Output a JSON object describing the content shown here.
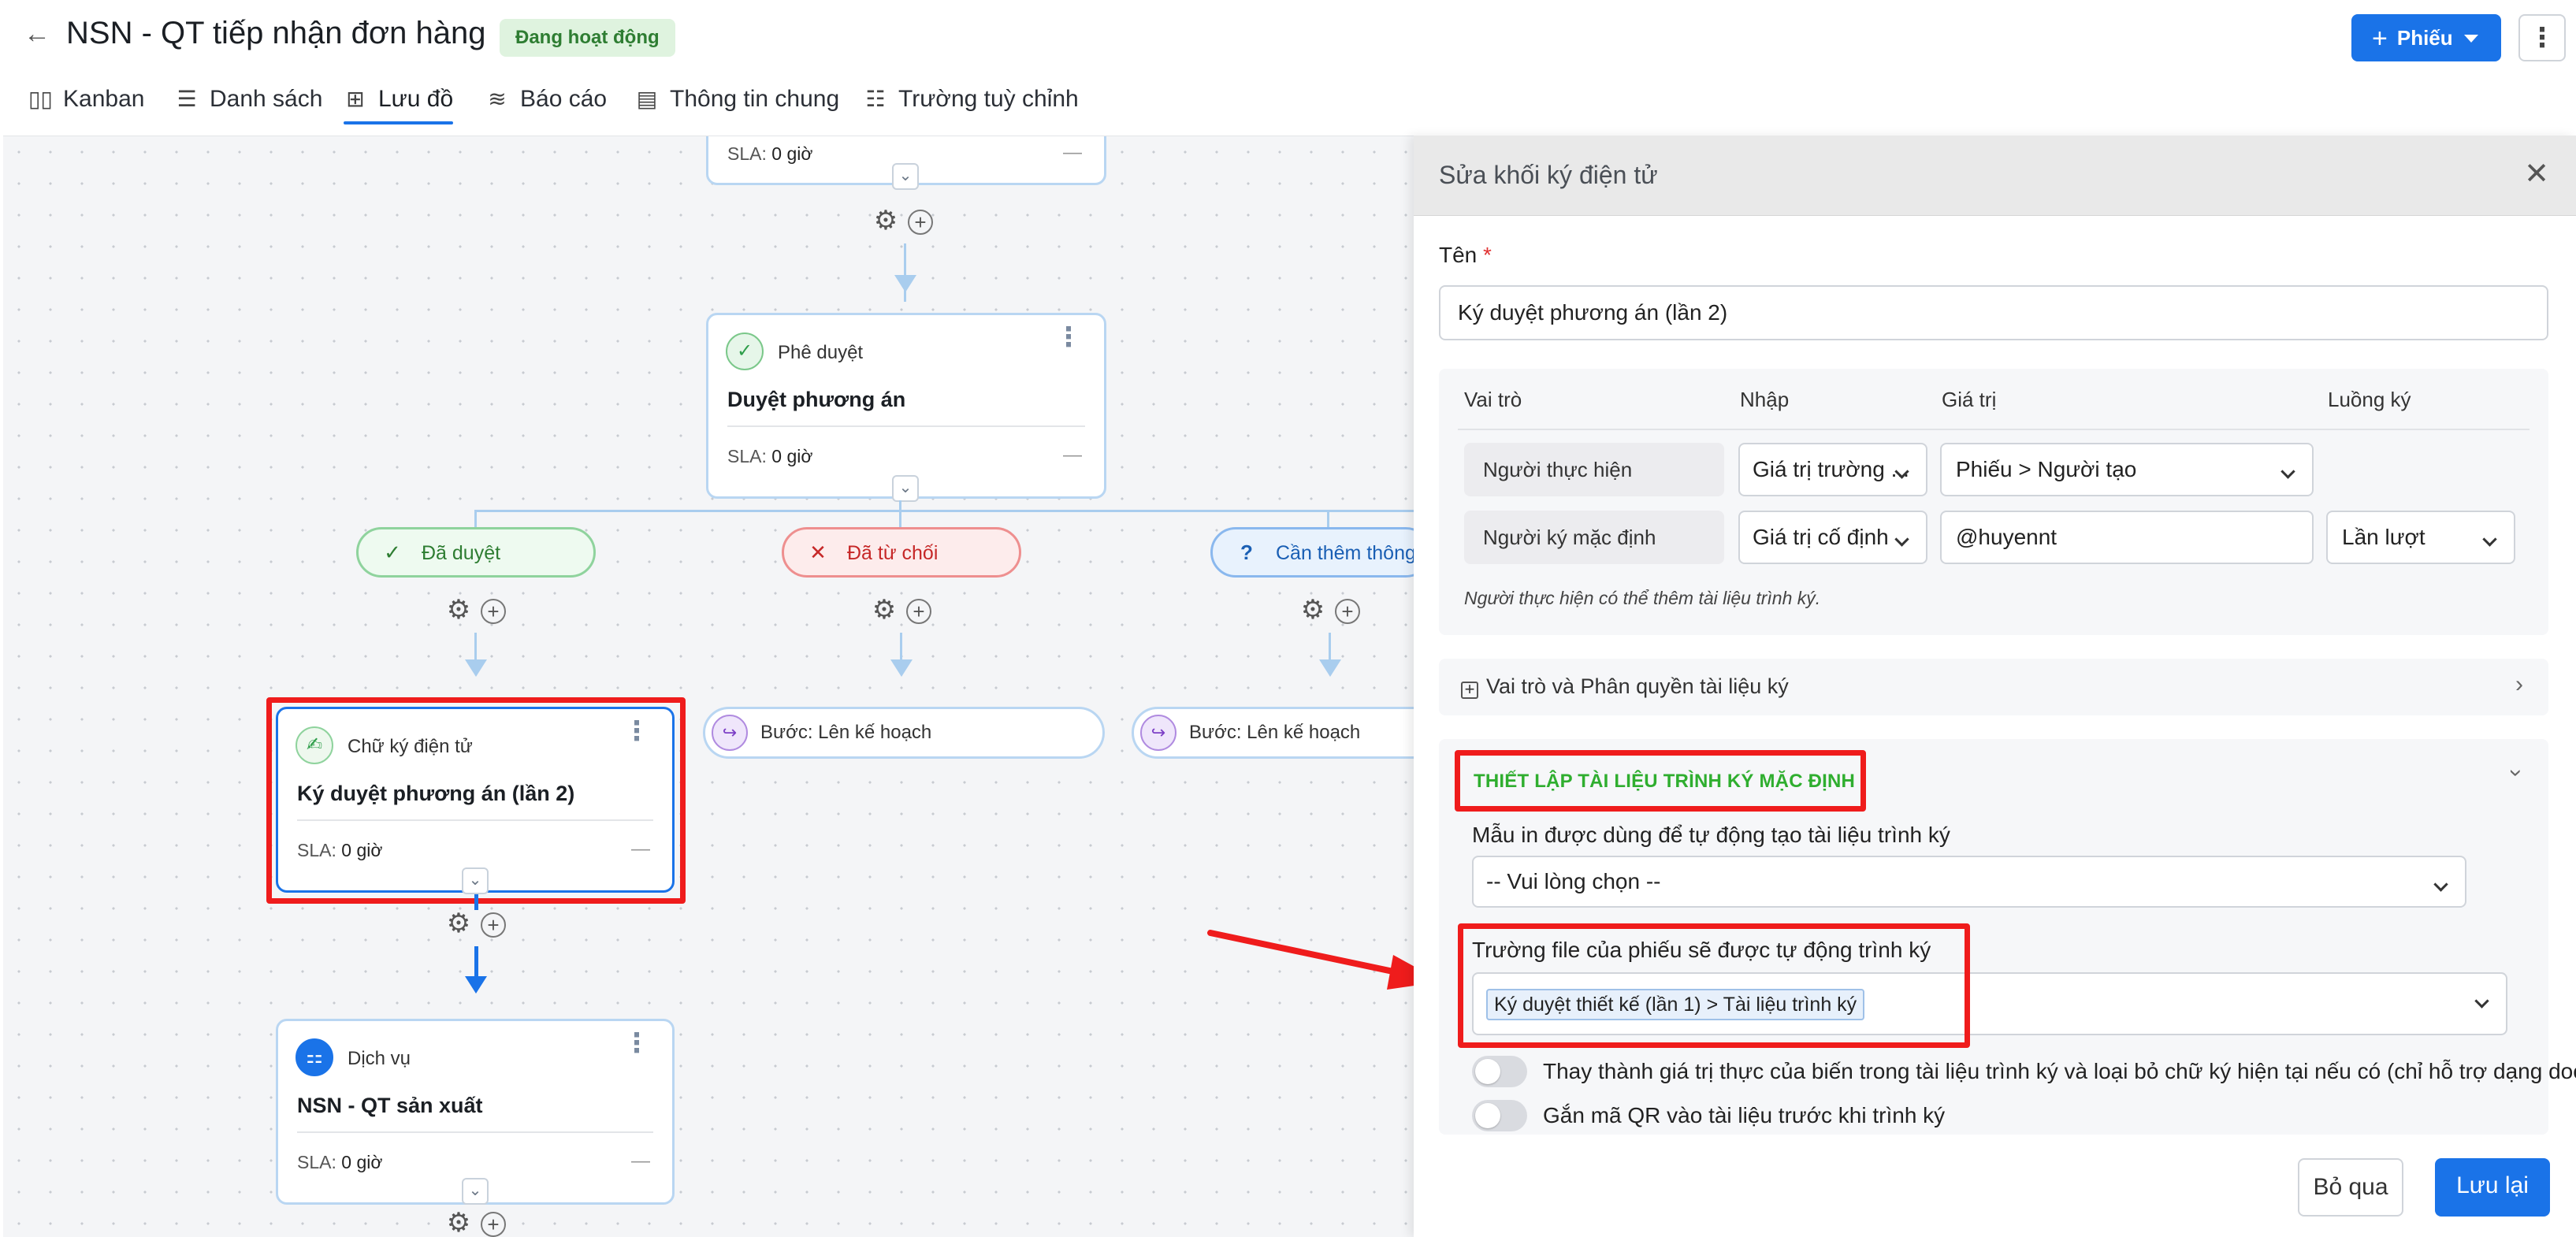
{
  "header": {
    "back_icon": "arrow-left-icon",
    "title": "NSN - QT tiếp nhận đơn hàng",
    "status_badge": "Đang hoạt động",
    "primary_button": "Phiếu",
    "more_icon": "more-vertical-icon"
  },
  "tabs": [
    {
      "label": "Kanban",
      "icon": "kanban-icon"
    },
    {
      "label": "Danh sách",
      "icon": "list-icon"
    },
    {
      "label": "Lưu đồ",
      "icon": "flowchart-icon",
      "active": true
    },
    {
      "label": "Báo cáo",
      "icon": "report-icon"
    },
    {
      "label": "Thông tin chung",
      "icon": "info-icon"
    },
    {
      "label": "Trường tuỳ chỉnh",
      "icon": "custom-fields-icon"
    }
  ],
  "flow": {
    "top_node": {
      "sla_label": "SLA:",
      "sla_value": "0 giờ",
      "dash": "—"
    },
    "approve_node": {
      "type": "Phê duyệt",
      "name": "Duyệt phương án",
      "sla_label": "SLA:",
      "sla_value": "0 giờ",
      "dash": "—"
    },
    "branches": [
      {
        "label": "Đã duyệt",
        "icon": "✓",
        "color": "#2e9e4a"
      },
      {
        "label": "Đã từ chối",
        "icon": "✕",
        "color": "#e03131"
      },
      {
        "label": "Cần thêm thông tin",
        "icon": "?",
        "color": "#1a73e8"
      }
    ],
    "esign_node": {
      "type": "Chữ ký điện tử",
      "name": "Ký duyệt phương án (lần 2)",
      "sla_label": "SLA:",
      "sla_value": "0 giờ",
      "dash": "—"
    },
    "step_reject": "Bước: Lên kế hoạch",
    "step_info": "Bước: Lên kế hoạch",
    "service_node": {
      "type": "Dịch vụ",
      "name": "NSN - QT sản xuất",
      "sla_label": "SLA:",
      "sla_value": "0 giờ",
      "dash": "—"
    }
  },
  "panel": {
    "title": "Sửa khối ký điện tử",
    "close_icon": "close-icon",
    "name_label": "Tên",
    "required_mark": "*",
    "name_value": "Ký duyệt phương án (lần 2)",
    "table": {
      "headers": [
        "Vai trò",
        "Nhập",
        "Giá trị",
        "Luồng ký"
      ],
      "rows": [
        {
          "role": "Người thực hiện",
          "input": "Giá trị trường ...",
          "value": "Phiếu > Người tạo",
          "flow": ""
        },
        {
          "role": "Người ký mặc định",
          "input": "Giá trị cố định",
          "value": "@huyennt",
          "flow": "Lần lượt"
        }
      ],
      "hint": "Người thực hiện có thể thêm tài liệu trình ký."
    },
    "roles_accordion": "Vai trò và Phân quyền tài liệu ký",
    "default_doc_title": "THIẾT LẬP TÀI LIỆU TRÌNH KÝ MẶC ĐỊNH",
    "template_label": "Mẫu in được dùng để tự động tạo tài liệu trình ký",
    "template_placeholder": "-- Vui lòng chọn --",
    "file_field_label": "Trường file của phiếu sẽ được tự động trình ký",
    "file_field_value": "Ký duyệt thiết kế (lần 1) > Tài liệu trình ký",
    "toggle_replace": "Thay thành giá trị thực của biến trong tài liệu trình ký và loại bỏ chữ ký hiện tại nếu có (chỉ hỗ trợ dạng docx)",
    "toggle_qr": "Gắn mã QR vào tài liệu trước khi trình ký",
    "cancel_button": "Bỏ qua",
    "save_button": "Lưu lại"
  },
  "colors": {
    "accent": "#1a73e8",
    "highlight": "#ef1c1c",
    "success": "#2fae2f"
  }
}
